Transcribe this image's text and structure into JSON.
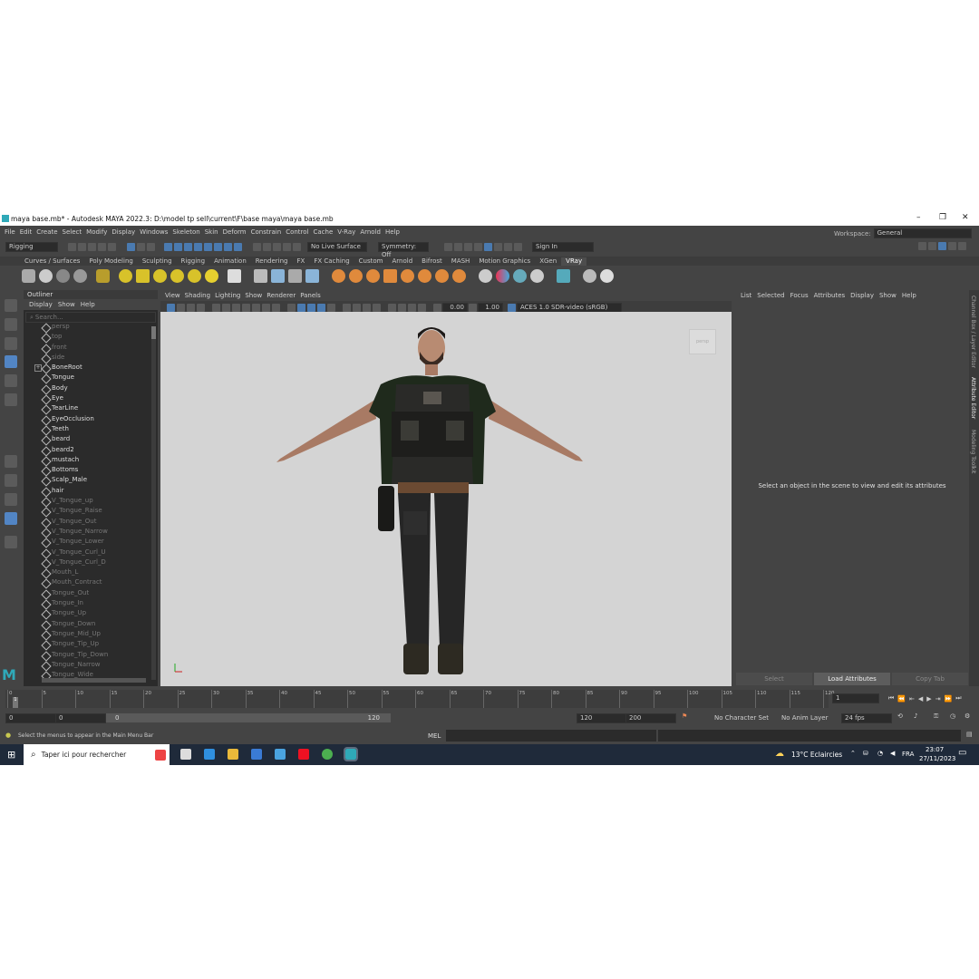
{
  "window": {
    "title": "maya base.mb* - Autodesk MAYA 2022.3: D:\\model tp sell\\current\\F\\base maya\\maya base.mb"
  },
  "menubar": {
    "items": [
      "File",
      "Edit",
      "Create",
      "Select",
      "Modify",
      "Display",
      "Windows",
      "Skeleton",
      "Skin",
      "Deform",
      "Constrain",
      "Control",
      "Cache",
      "V-Ray",
      "Arnold",
      "Help"
    ],
    "workspace_label": "Workspace:",
    "workspace_value": "General"
  },
  "statusline": {
    "mode": "Rigging",
    "live_surface": "No Live Surface",
    "symmetry": "Symmetry: Off",
    "sign_in": "Sign In"
  },
  "shelf_tabs": [
    "Curves / Surfaces",
    "Poly Modeling",
    "Sculpting",
    "Rigging",
    "Animation",
    "Rendering",
    "FX",
    "FX Caching",
    "Custom",
    "Arnold",
    "Bifrost",
    "MASH",
    "Motion Graphics",
    "XGen",
    "VRay"
  ],
  "shelf_active": "VRay",
  "outliner": {
    "title": "Outliner",
    "menu": [
      "Display",
      "Show",
      "Help"
    ],
    "search_placeholder": "Search...",
    "items": [
      {
        "label": "persp",
        "dim": true
      },
      {
        "label": "top",
        "dim": true
      },
      {
        "label": "front",
        "dim": true
      },
      {
        "label": "side",
        "dim": true
      },
      {
        "label": "BoneRoot",
        "dim": false,
        "expand": true
      },
      {
        "label": "Tongue",
        "dim": false
      },
      {
        "label": "Body",
        "dim": false
      },
      {
        "label": "Eye",
        "dim": false
      },
      {
        "label": "TearLine",
        "dim": false
      },
      {
        "label": "EyeOcclusion",
        "dim": false
      },
      {
        "label": "Teeth",
        "dim": false
      },
      {
        "label": "beard",
        "dim": false
      },
      {
        "label": "beard2",
        "dim": false
      },
      {
        "label": "mustach",
        "dim": false
      },
      {
        "label": "Bottoms",
        "dim": false
      },
      {
        "label": "Scalp_Male",
        "dim": false
      },
      {
        "label": "hair",
        "dim": false
      },
      {
        "label": "V_Tongue_up",
        "dim": true
      },
      {
        "label": "V_Tongue_Raise",
        "dim": true
      },
      {
        "label": "V_Tongue_Out",
        "dim": true
      },
      {
        "label": "V_Tongue_Narrow",
        "dim": true
      },
      {
        "label": "V_Tongue_Lower",
        "dim": true
      },
      {
        "label": "V_Tongue_Curl_U",
        "dim": true
      },
      {
        "label": "V_Tongue_Curl_D",
        "dim": true
      },
      {
        "label": "Mouth_L",
        "dim": true
      },
      {
        "label": "Mouth_Contract",
        "dim": true
      },
      {
        "label": "Tongue_Out",
        "dim": true
      },
      {
        "label": "Tongue_In",
        "dim": true
      },
      {
        "label": "Tongue_Up",
        "dim": true
      },
      {
        "label": "Tongue_Down",
        "dim": true
      },
      {
        "label": "Tongue_Mid_Up",
        "dim": true
      },
      {
        "label": "Tongue_Tip_Up",
        "dim": true
      },
      {
        "label": "Tongue_Tip_Down",
        "dim": true
      },
      {
        "label": "Tongue_Narrow",
        "dim": true
      },
      {
        "label": "Tongue_Wide",
        "dim": true
      }
    ]
  },
  "panel_menu": [
    "View",
    "Shading",
    "Lighting",
    "Show",
    "Renderer",
    "Panels"
  ],
  "panel_tools": {
    "exposure": "0.00",
    "gamma": "1.00",
    "colorspace": "ACES 1.0 SDR-video (sRGB)"
  },
  "viewport": {
    "camera_label": "persp"
  },
  "attribute_editor": {
    "menu": [
      "List",
      "Selected",
      "Focus",
      "Attributes",
      "Display",
      "Show",
      "Help"
    ],
    "message": "Select an object in the scene to view and edit its attributes",
    "buttons": [
      "Select",
      "Load Attributes",
      "Copy Tab"
    ]
  },
  "side_tabs": [
    "Channel Box / Layer Editor",
    "Attribute Editor",
    "Modeling Toolkit"
  ],
  "timeline": {
    "ticks": [
      "0",
      "5",
      "10",
      "15",
      "20",
      "25",
      "30",
      "35",
      "40",
      "45",
      "50",
      "55",
      "60",
      "65",
      "70",
      "75",
      "80",
      "85",
      "90",
      "95",
      "100",
      "105",
      "110",
      "115",
      "120"
    ],
    "current_frame": "1",
    "current_frame_marker": "1"
  },
  "range": {
    "start": "0",
    "start_inner": "0",
    "slider_start": "0",
    "slider_end": "120",
    "end_inner": "120",
    "end": "200",
    "character_set": "No Character Set",
    "anim_layer": "No Anim Layer",
    "fps": "24 fps"
  },
  "cmdline": {
    "help": "Select the menus to appear in the Main Menu Bar",
    "mel": "MEL"
  },
  "taskbar": {
    "search": "Taper ici pour rechercher",
    "weather": "13°C  Eclaircies",
    "lang": "FRA",
    "time": "23:07",
    "date": "27/11/2023"
  },
  "colors": {
    "accent": "#5285c4",
    "maya_teal": "#2fa9b8",
    "vray_tab": "#4d4d4d",
    "viewport_bg": "#d4d4d4"
  }
}
